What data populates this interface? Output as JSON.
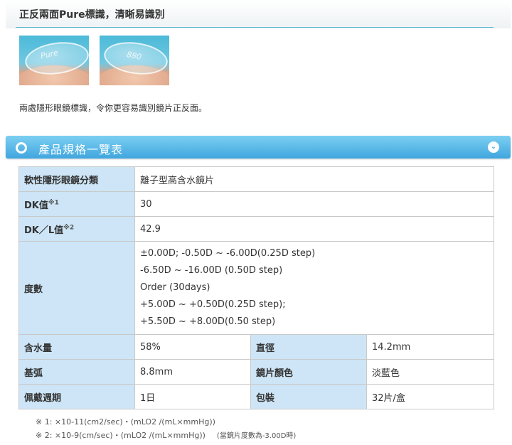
{
  "feature": {
    "title": "正反兩面Pure標識，清晰易識別",
    "photo1_mark": "Pure",
    "photo2_mark": "880",
    "description": "兩處隱形眼鏡標識，令你更容易識別鏡片正反面。"
  },
  "spec_section": {
    "title": "產品規格一覽表",
    "toggle_icon": "chevron-down-icon"
  },
  "table": {
    "category_label": "軟性隱形眼鏡分類",
    "category_value": "離子型高含水鏡片",
    "dk_label": "DK值",
    "dk_note": "※1",
    "dk_value": "30",
    "dkl_label": "DK／L值",
    "dkl_note": "※2",
    "dkl_value": "42.9",
    "power_label": "度數",
    "power_lines": [
      "±0.00D; -0.50D ~ -6.00D(0.25D step)",
      "-6.50D ~ -16.00D (0.50D step)",
      "Order (30days)",
      "+5.00D ~ +0.50D(0.25D step);",
      "+5.50D ~ +8.00D(0.50 step)"
    ],
    "water_label": "含水量",
    "water_value": "58%",
    "diameter_label": "直徑",
    "diameter_value": "14.2mm",
    "base_label": "基弧",
    "base_value": "8.8mm",
    "color_label": "鏡片顏色",
    "color_value": "淡藍色",
    "period_label": "佩戴週期",
    "period_value": "1日",
    "pack_label": "包裝",
    "pack_value": "32片/盒"
  },
  "notes": {
    "note1": "※ 1: ×10-11(cm2/sec)・(mLO2 /(mL×mmHg))",
    "note2": "※ 2: ×10-9(cm/sec)・(mLO2 /(mL×mmHg))",
    "note2_extra": "(當鏡片度數為-3.00D時)"
  }
}
